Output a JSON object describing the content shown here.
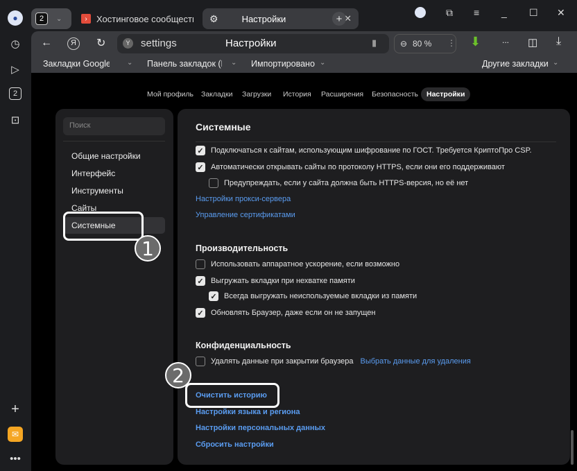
{
  "tabs": {
    "count": "2",
    "tab1": "Хостинговое сообщество",
    "tab2": "Настройки"
  },
  "toolbar": {
    "url": "settings",
    "page_title": "Настройки",
    "zoom": "80 %",
    "more": "..."
  },
  "bookmarks": {
    "b1": "Закладки Google Ch",
    "b2": "Панель закладок (Ed",
    "b3": "Импортировано",
    "other": "Другие закладки"
  },
  "nav": [
    "Мой профиль",
    "Закладки",
    "Загрузки",
    "История",
    "Расширения",
    "Безопасность",
    "Настройки"
  ],
  "sidebar": {
    "search_placeholder": "Поиск",
    "items": [
      "Общие настройки",
      "Интерфейс",
      "Инструменты",
      "Сайты",
      "Системные"
    ]
  },
  "main": {
    "system_title": "Системные",
    "gost": "Подключаться к сайтам, использующим шифрование по ГОСТ. Требуется КриптоПро CSP.",
    "https": "Автоматически открывать сайты по протоколу HTTPS, если они его поддерживают",
    "https_warn": "Предупреждать, если у сайта должна быть HTTPS-версия, но её нет",
    "proxy": "Настройки прокси-сервера",
    "certs": "Управление сертификатами",
    "perf_title": "Производительность",
    "hw": "Использовать аппаратное ускорение, если возможно",
    "unload": "Выгружать вкладки при нехватке памяти",
    "unload_always": "Всегда выгружать неиспользуемые вкладки из памяти",
    "update": "Обновлять Браузер, даже если он не запущен",
    "privacy_title": "Конфиденциальность",
    "clear_on_close": "Удалять данные при закрытии браузера",
    "choose_data": "Выбрать данные для удаления",
    "clear_history": "Очистить историю",
    "lang": "Настройки языка и региона",
    "personal": "Настройки персональных данных",
    "reset": "Сбросить настройки"
  },
  "annotations": {
    "one": "1",
    "two": "2"
  }
}
